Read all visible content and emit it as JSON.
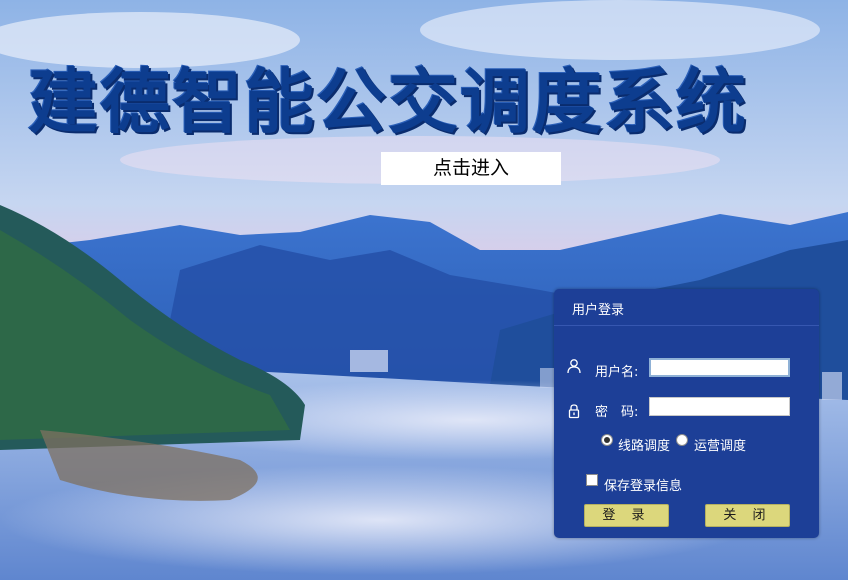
{
  "app": {
    "title": "建德智能公交调度系统",
    "enter_button": "点击进入"
  },
  "login": {
    "header": "用户登录",
    "username_label": "用户名:",
    "username_value": "",
    "password_label": "密　码:",
    "password_value": "",
    "mode_options": [
      {
        "label": "线路调度",
        "checked": true
      },
      {
        "label": "运营调度",
        "checked": false
      }
    ],
    "remember_label": "保存登录信息",
    "remember_checked": false,
    "login_button": "登 录",
    "close_button": "关 闭"
  },
  "colors": {
    "panel_bg": "#1d3f97",
    "title_text": "#0d3d8f",
    "button_bg": "#dcd77c"
  },
  "icons": {
    "user": "user-icon",
    "lock": "lock-icon"
  }
}
